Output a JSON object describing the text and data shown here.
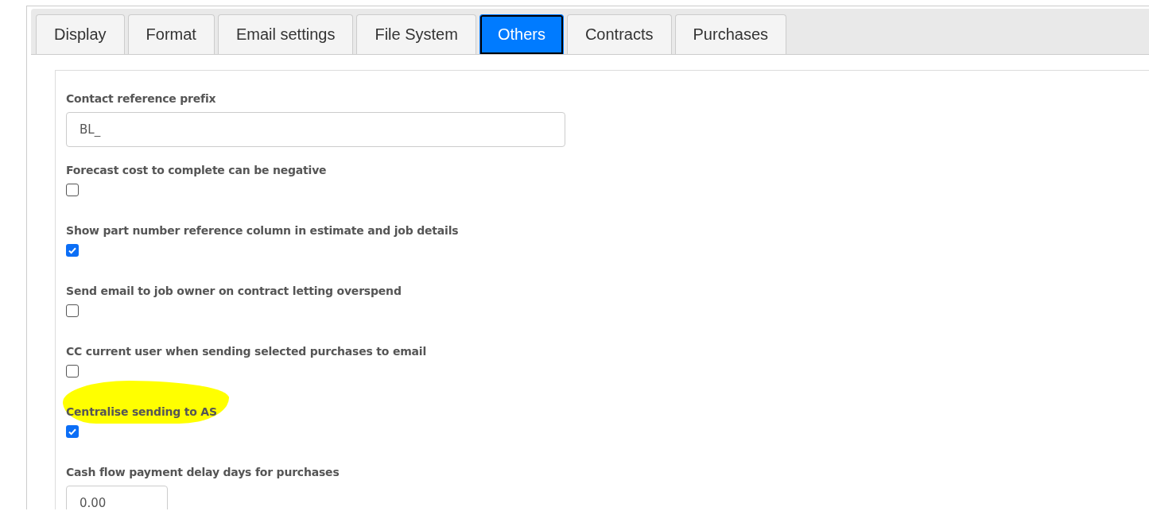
{
  "tabs": [
    {
      "label": "Display",
      "selected": false
    },
    {
      "label": "Format",
      "selected": false
    },
    {
      "label": "Email settings",
      "selected": false
    },
    {
      "label": "File System",
      "selected": false
    },
    {
      "label": "Others",
      "selected": true
    },
    {
      "label": "Contracts",
      "selected": false
    },
    {
      "label": "Purchases",
      "selected": false
    }
  ],
  "fields": [
    {
      "kind": "text",
      "label": "Contact reference prefix",
      "value": "BL_",
      "highlighted": false
    },
    {
      "kind": "checkbox",
      "label": "Forecast cost to complete can be negative",
      "checked": false,
      "highlighted": false
    },
    {
      "kind": "checkbox",
      "label": "Show part number reference column in estimate and job details",
      "checked": true,
      "highlighted": false
    },
    {
      "kind": "checkbox",
      "label": "Send email to job owner on contract letting overspend",
      "checked": false,
      "highlighted": false
    },
    {
      "kind": "checkbox",
      "label": "CC current user when sending selected purchases to email",
      "checked": false,
      "highlighted": false
    },
    {
      "kind": "checkbox",
      "label": "Centralise sending to AS",
      "checked": true,
      "highlighted": true
    },
    {
      "kind": "number",
      "label": "Cash flow payment delay days for purchases",
      "value": "0.00",
      "highlighted": false
    }
  ]
}
